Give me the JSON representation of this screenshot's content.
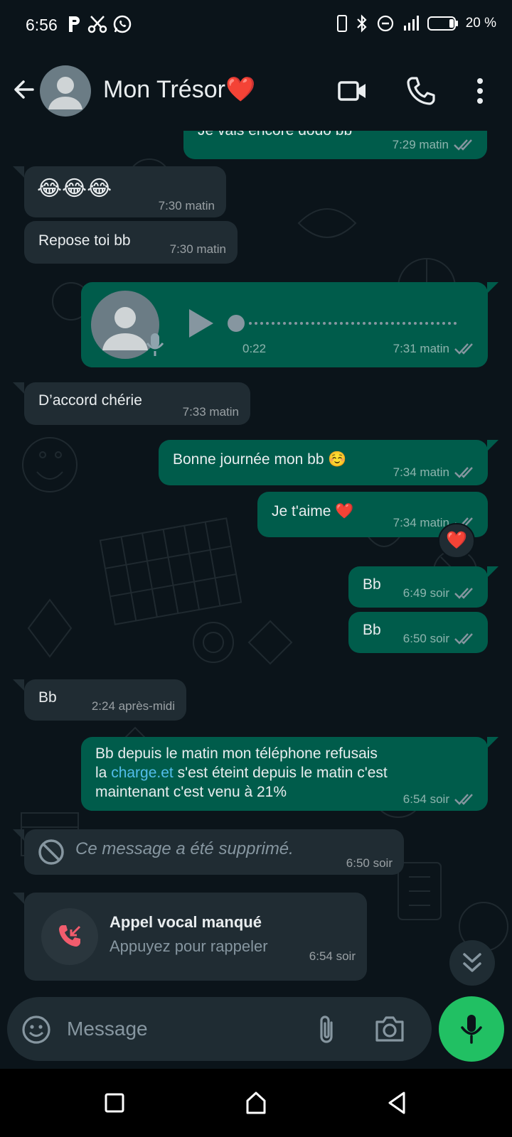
{
  "status_bar": {
    "time": "6:56",
    "battery": "20 %"
  },
  "header": {
    "contact_name": "Mon Trésor❤️"
  },
  "messages": [
    {
      "type": "out",
      "text": "Je vais encore dodo bb",
      "time": "7:29 matin"
    },
    {
      "type": "in",
      "text": "😂😂😂",
      "time": "7:30 matin"
    },
    {
      "type": "in",
      "text": "Repose toi bb",
      "time": "7:30 matin"
    },
    {
      "type": "out-voice",
      "duration": "0:22",
      "time": "7:31 matin"
    },
    {
      "type": "in",
      "text": "D’accord chérie",
      "time": "7:33 matin"
    },
    {
      "type": "out",
      "text": "Bonne journée mon bb ☺️",
      "time": "7:34 matin"
    },
    {
      "type": "out",
      "text": "Je t'aime ❤️",
      "time": "7:34 matin",
      "reaction": "❤️"
    },
    {
      "type": "out",
      "text": "Bb",
      "time": "6:49 soir"
    },
    {
      "type": "out",
      "text": "Bb",
      "time": "6:50 soir"
    },
    {
      "type": "in",
      "text": "Bb",
      "time": "2:24 après-midi"
    },
    {
      "type": "out",
      "line1": "Bb depuis le matin mon téléphone refusais",
      "line2_prefix": "la ",
      "line2_link": "charge.et",
      "line2_suffix": " s'est éteint depuis le matin c'est",
      "line3": "maintenant c'est venu à 21%",
      "time": "6:54 soir"
    },
    {
      "type": "in-deleted",
      "text": "Ce message a été supprimé.",
      "time": "6:50 soir"
    },
    {
      "type": "in-missed-call",
      "title": "Appel vocal manqué",
      "subtitle": "Appuyez pour rappeler",
      "time": "6:54 soir"
    }
  ],
  "input": {
    "placeholder": "Message"
  },
  "colors": {
    "background": "#0b141a",
    "incoming_bubble": "#202c33",
    "outgoing_bubble": "#005c4b",
    "accent_green": "#21c063",
    "link": "#53bdeb",
    "missed_call_red": "#f15c6d"
  }
}
